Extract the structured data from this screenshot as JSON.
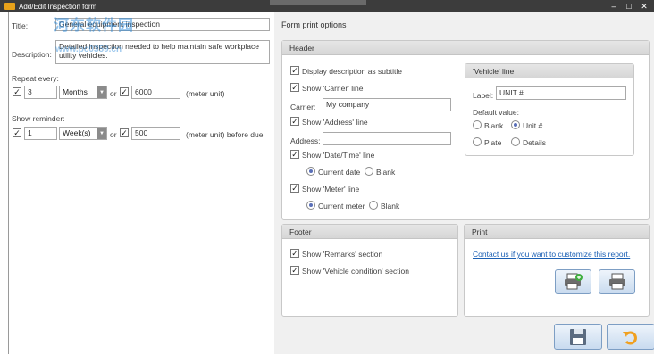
{
  "window": {
    "title": "Add/Edit Inspection form"
  },
  "watermark": {
    "text": "河东软件园",
    "url": "www.pc0359.cn"
  },
  "left": {
    "title_label": "Title:",
    "title_value": "General equipment inspection",
    "description_label": "Description:",
    "description_value": "Detailed inspection needed to help maintain safe workplace utility vehicles.",
    "repeat_label": "Repeat every:",
    "repeat_count": "3",
    "repeat_unit": "Months",
    "or_label": "or",
    "repeat_meter": "6000",
    "meter_unit": "(meter unit)",
    "reminder_label": "Show reminder:",
    "reminder_count": "1",
    "reminder_unit": "Week(s)",
    "reminder_meter": "500",
    "reminder_meter_unit": "(meter unit) before due"
  },
  "right": {
    "pane_title": "Form print options",
    "header": {
      "title": "Header",
      "display_desc": "Display description as subtitle",
      "show_carrier": "Show 'Carrier' line",
      "carrier_label": "Carrier:",
      "carrier_value": "My company",
      "show_address": "Show 'Address' line",
      "address_label": "Address:",
      "address_value": "",
      "show_datetime": "Show 'Date/Time' line",
      "current_date": "Current date",
      "blank": "Blank",
      "show_meter": "Show 'Meter' line",
      "current_meter": "Current meter",
      "blank2": "Blank"
    },
    "vehicle": {
      "title": "'Vehicle' line",
      "label_label": "Label:",
      "label_value": "UNIT #",
      "default_value": "Default value:",
      "opt_blank": "Blank",
      "opt_unit": "Unit #",
      "opt_plate": "Plate",
      "opt_details": "Details"
    },
    "footer": {
      "title": "Footer",
      "show_remarks": "Show 'Remarks' section",
      "show_condition": "Show 'Vehicle condition' section"
    },
    "print": {
      "title": "Print",
      "link": "Contact us if you want to customize this report."
    }
  },
  "colors": {
    "accent": "#1a5fb4",
    "button_border": "#7d9ec4"
  }
}
